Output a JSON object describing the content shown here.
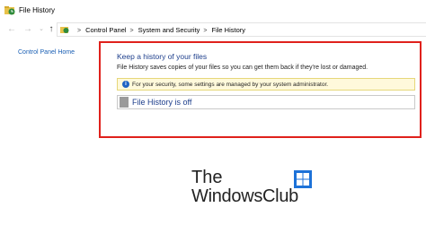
{
  "window": {
    "title": "File History",
    "app_icon": "file-history-icon"
  },
  "navigation": {
    "back_icon": "arrow-left-icon",
    "forward_icon": "arrow-right-icon",
    "recent_icon": "chevron-down-icon",
    "up_icon": "arrow-up-icon",
    "breadcrumbs": [
      "Control Panel",
      "System and Security",
      "File History"
    ],
    "separator": ">"
  },
  "sidebar": {
    "home_link": "Control Panel Home"
  },
  "main": {
    "heading": "Keep a history of your files",
    "description": "File History saves copies of your files so you can get them back if they're lost or damaged.",
    "info_bar": {
      "icon": "info-icon",
      "text": "For your security, some settings are managed by your system administrator."
    },
    "status": "File History is off"
  },
  "watermark": {
    "line1": "The",
    "line2": "WindowsClub",
    "logo": "windows-logo-icon"
  },
  "colors": {
    "highlight": "#e0211c",
    "link": "#1a5fb4",
    "heading": "#1e3f8c",
    "info_background": "#fff9db"
  }
}
